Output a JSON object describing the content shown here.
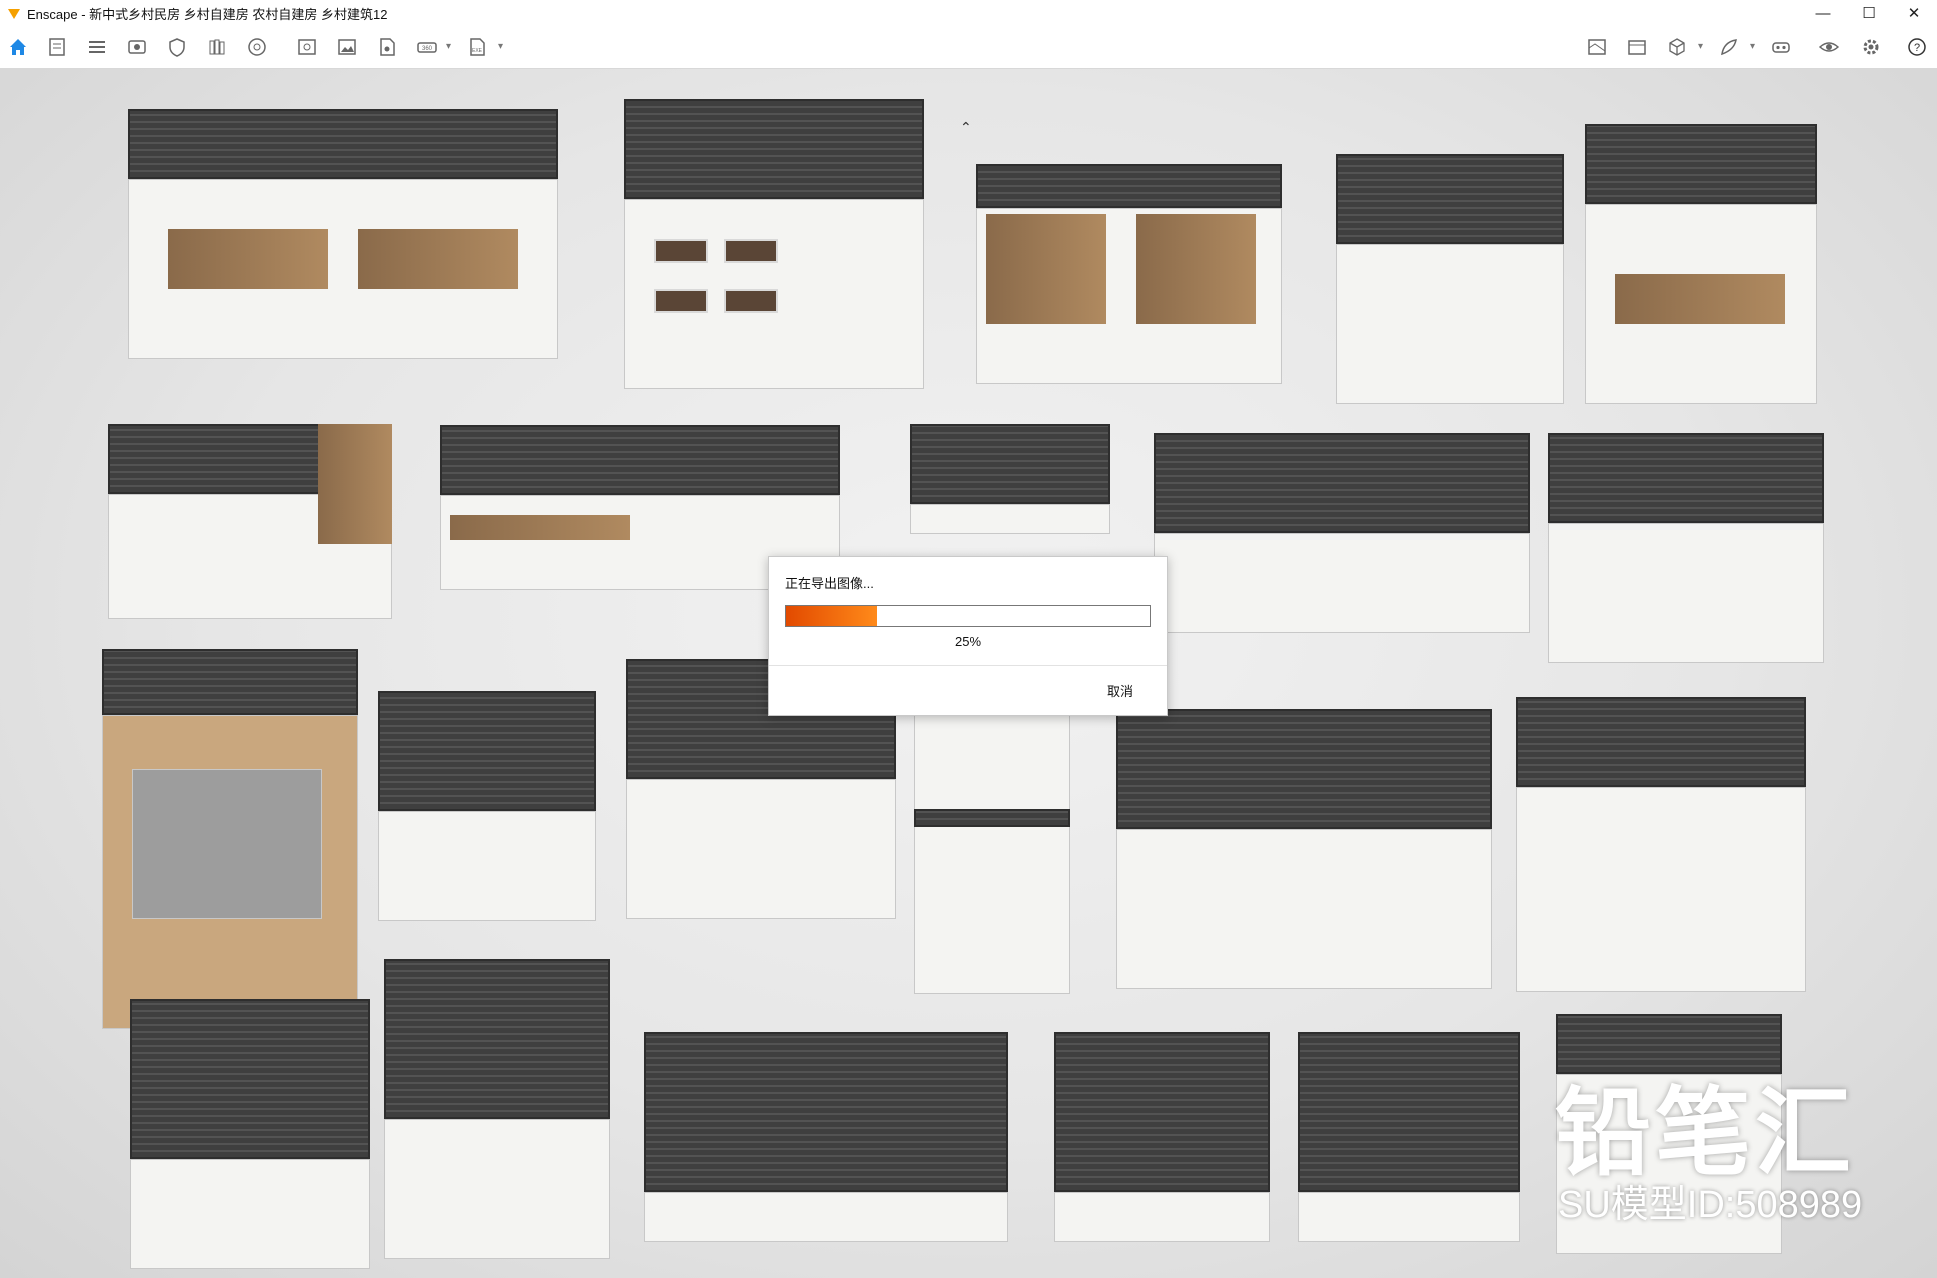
{
  "window": {
    "app_name": "Enscape",
    "title": "Enscape - 新中式乡村民房 乡村自建房 农村自建房 乡村建筑12",
    "controls": {
      "minimize": "—",
      "maximize": "☐",
      "close": "✕"
    }
  },
  "toolbar": {
    "left_icons": [
      "home-icon",
      "document-icon",
      "list-icon",
      "view-icon",
      "shield-icon",
      "books-icon",
      "asset-library-icon",
      "screenshot-icon",
      "image-icon",
      "file-image-icon",
      "panorama-icon",
      "export-icon"
    ],
    "right_icons": [
      "map-icon",
      "gallery-icon",
      "cube-icon",
      "feather-icon",
      "vr-headset-icon",
      "eye-icon",
      "settings-icon",
      "help-icon"
    ],
    "collapse_label": "⌃",
    "help_label": "?"
  },
  "dialog": {
    "title": "正在导出图像...",
    "progress": 0.25,
    "progress_label": "25%",
    "cancel_label": "取消"
  },
  "watermark": {
    "brand": "铅笔汇",
    "model_id": "SU模型ID:508989"
  },
  "colors": {
    "accent": "#ff6a00",
    "home_icon": "#1e88e5",
    "roof": "#444444"
  }
}
